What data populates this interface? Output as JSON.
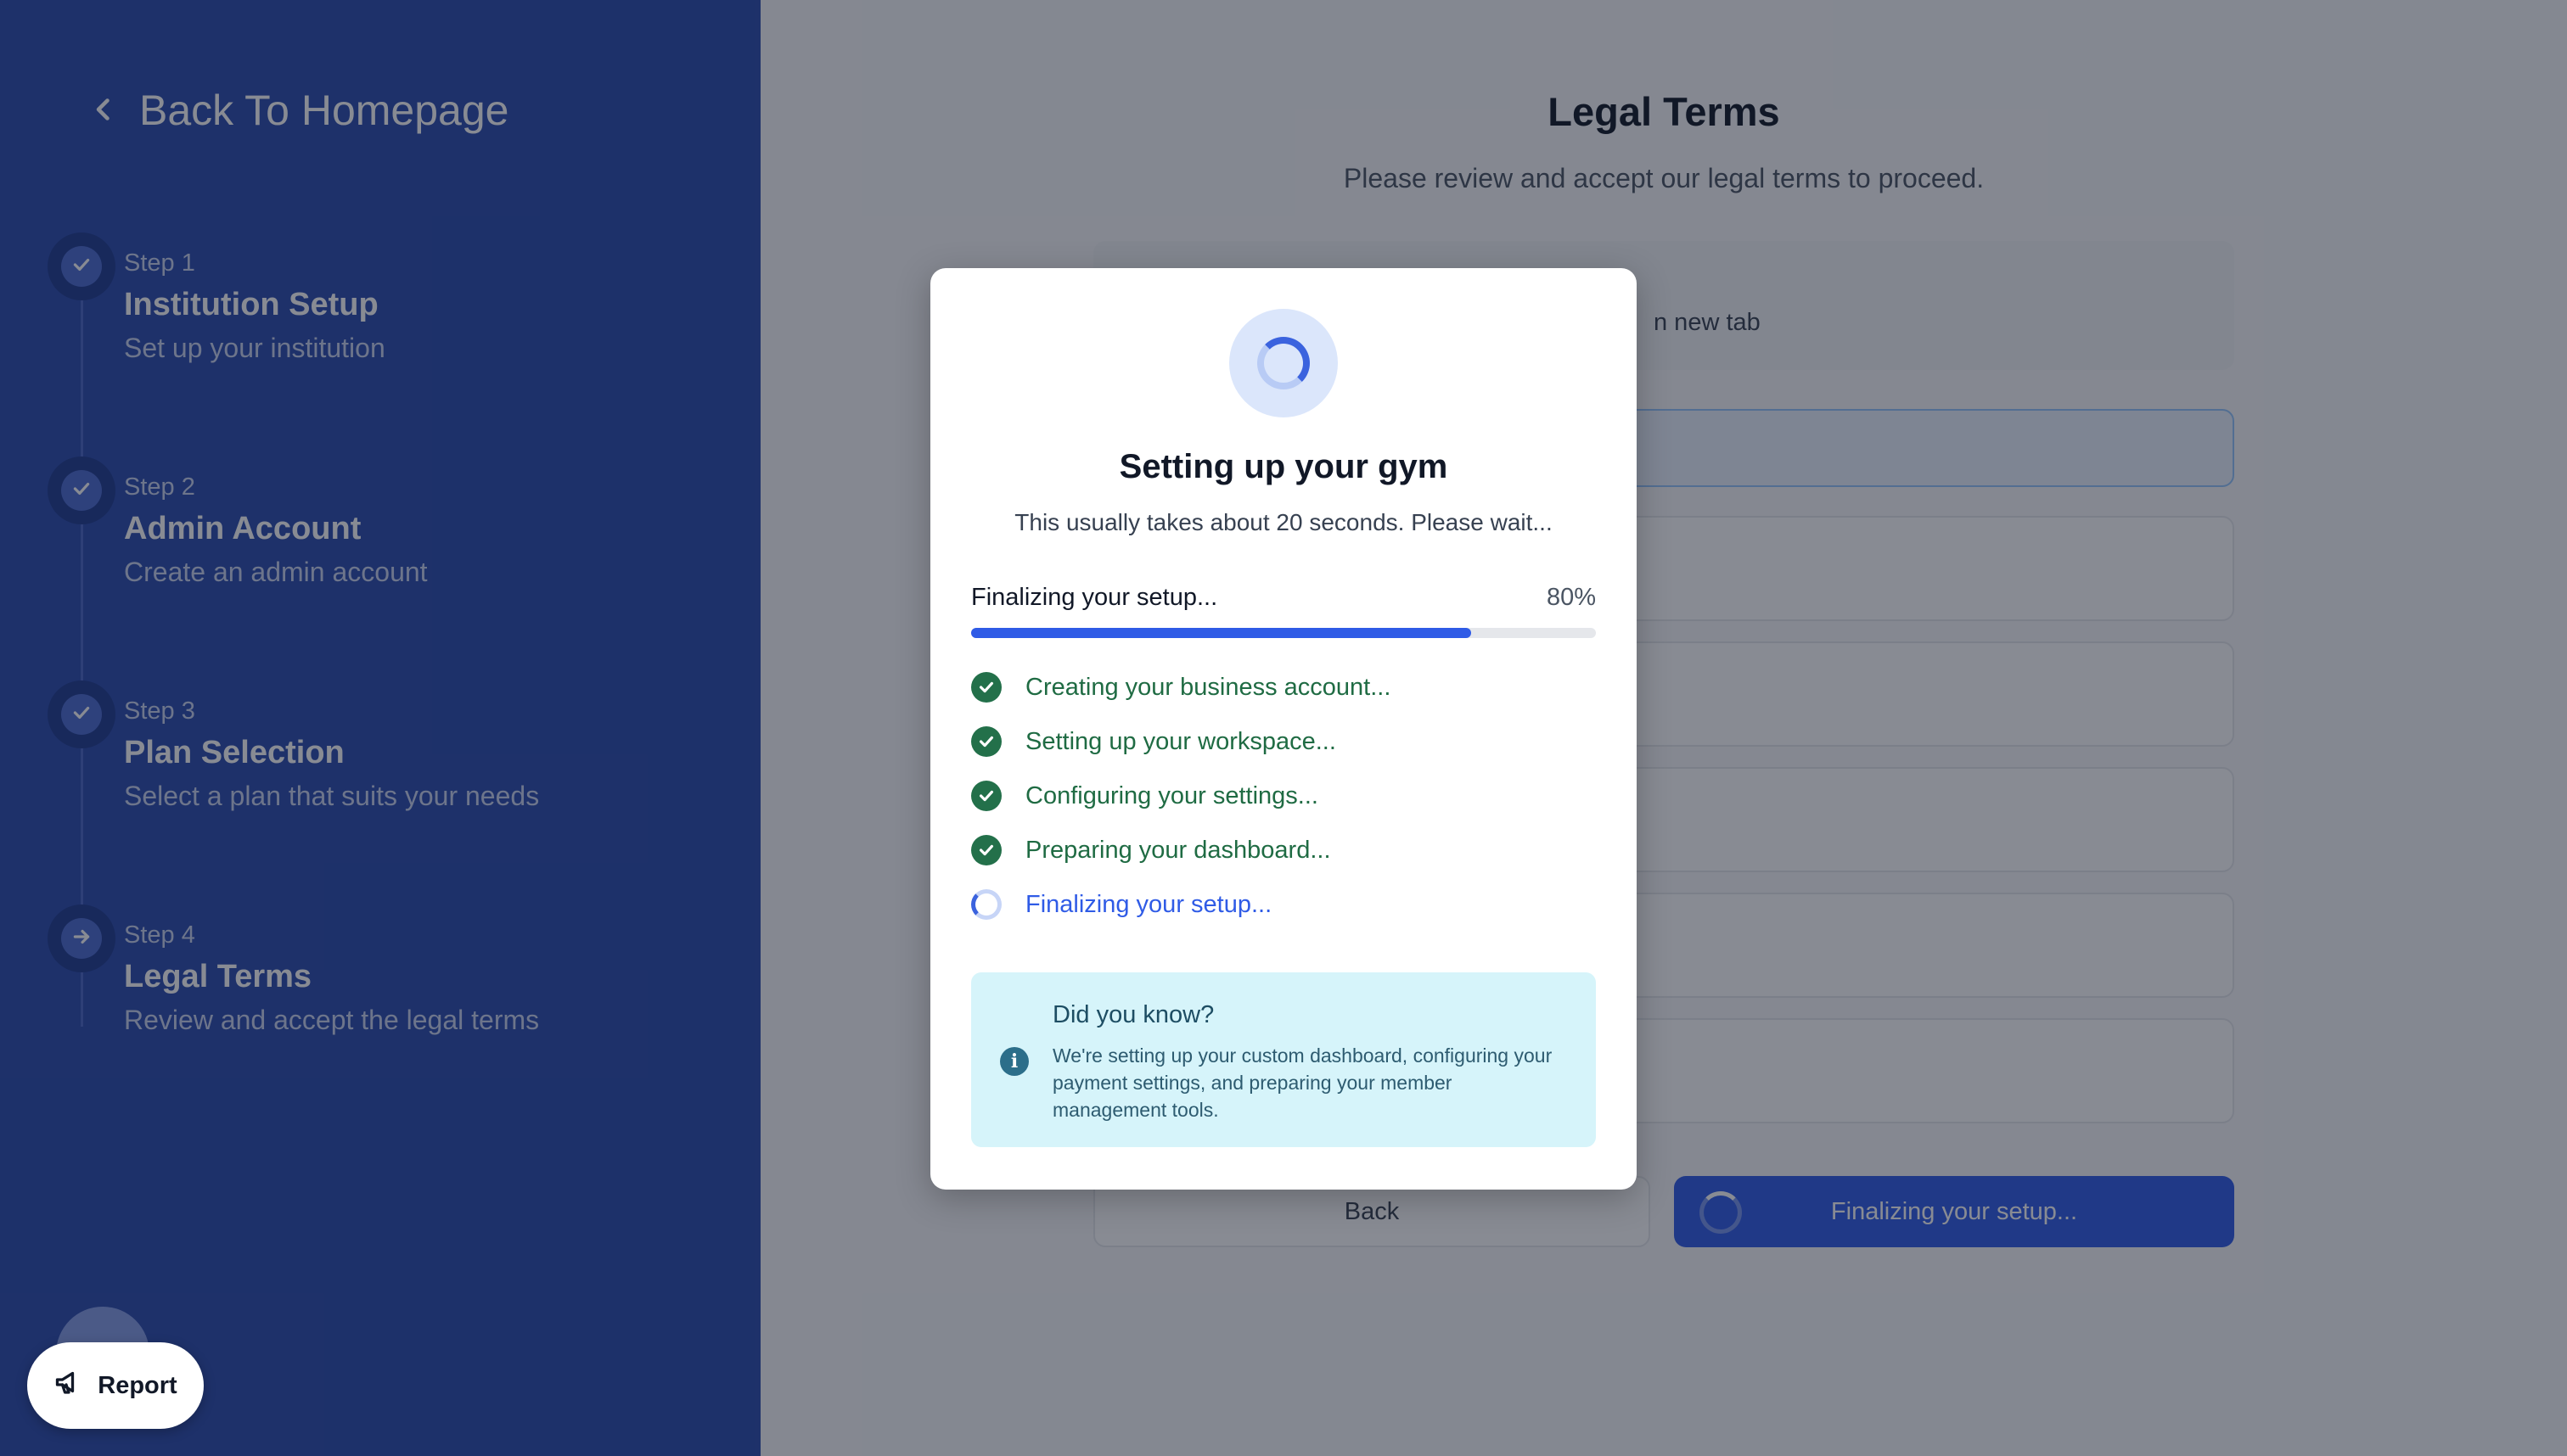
{
  "sidebar": {
    "back_label": "Back To Homepage",
    "steps": [
      {
        "number": "Step 1",
        "title": "Institution Setup",
        "description": "Set up your institution",
        "state": "completed"
      },
      {
        "number": "Step 2",
        "title": "Admin Account",
        "description": "Create an admin account",
        "state": "completed"
      },
      {
        "number": "Step 3",
        "title": "Plan Selection",
        "description": "Select a plan that suits your needs",
        "state": "completed"
      },
      {
        "number": "Step 4",
        "title": "Legal Terms",
        "description": "Review and accept the legal terms",
        "state": "current"
      }
    ]
  },
  "main": {
    "title": "Legal Terms",
    "subtitle": "Please review and accept our legal terms to proceed.",
    "info_fragment": "n new tab",
    "back_button": "Back",
    "submit_button": "Finalizing your setup..."
  },
  "modal": {
    "title": "Setting up your gym",
    "subtitle": "This usually takes about 20 seconds. Please wait...",
    "progress_label": "Finalizing your setup...",
    "progress_percent_text": "80%",
    "progress_value": 0.8,
    "tasks": [
      {
        "label": "Creating your business account...",
        "status": "done"
      },
      {
        "label": "Setting up your workspace...",
        "status": "done"
      },
      {
        "label": "Configuring your settings...",
        "status": "done"
      },
      {
        "label": "Preparing your dashboard...",
        "status": "done"
      },
      {
        "label": "Finalizing your setup...",
        "status": "in-progress"
      }
    ],
    "tip": {
      "title": "Did you know?",
      "text": "We're setting up your custom dashboard, configuring your payment settings, and preparing your member management tools."
    }
  },
  "report": {
    "label": "Report"
  },
  "colors": {
    "sidebar_bg": "#2a4aad",
    "primary": "#2f5be6",
    "success": "#23704a",
    "tip_bg": "#d6f4fa"
  },
  "icons": {
    "back": "chevron-left-icon",
    "step_done": "check-icon",
    "step_current": "arrow-right-icon",
    "loader": "spinner-icon",
    "info": "info-icon",
    "report": "megaphone-icon"
  }
}
